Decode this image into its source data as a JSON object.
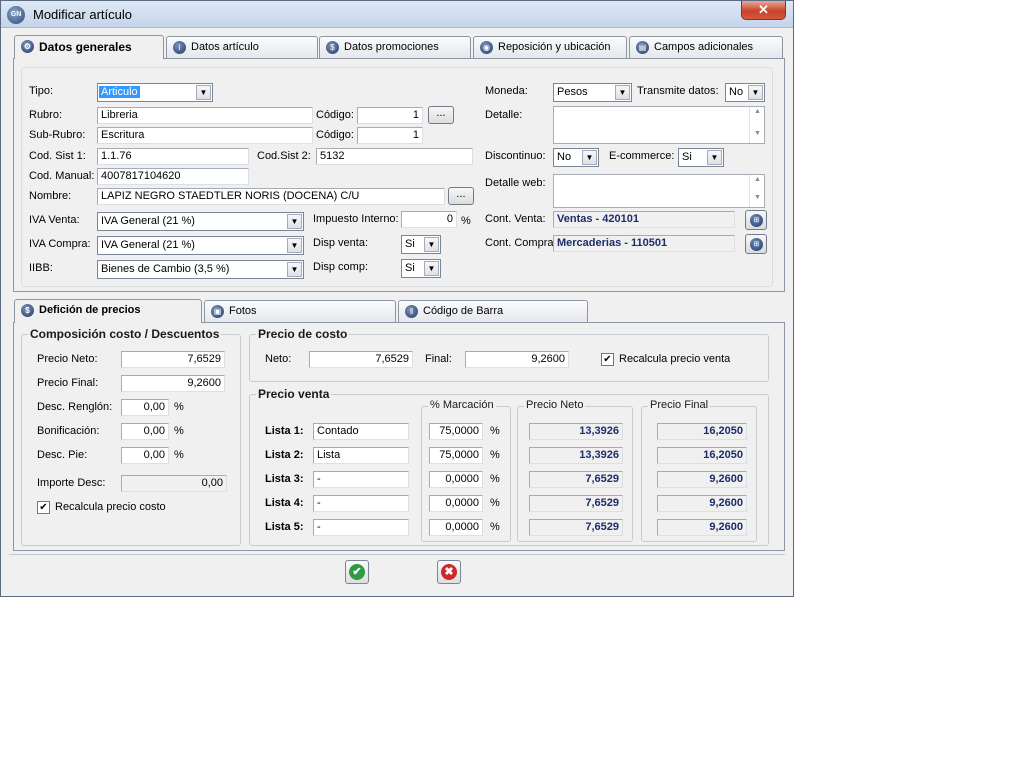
{
  "window": {
    "title": "Modificar artículo",
    "icon_text": "GN",
    "close_glyph": "✕"
  },
  "top_tabs": [
    {
      "label": "Datos generales",
      "icon": "gear-icon"
    },
    {
      "label": "Datos artículo",
      "icon": "info-icon"
    },
    {
      "label": "Datos promociones",
      "icon": "percent-icon"
    },
    {
      "label": "Reposición y ubicación",
      "icon": "box-icon"
    },
    {
      "label": "Campos adicionales",
      "icon": "folder-icon"
    }
  ],
  "general": {
    "tipo": {
      "label": "Tipo:",
      "value": "Articulo"
    },
    "rubro": {
      "label": "Rubro:",
      "value": "Libreria"
    },
    "rubro_codigo": {
      "label": "Código:",
      "value": "1"
    },
    "subrubro": {
      "label": "Sub-Rubro:",
      "value": "Escritura"
    },
    "subrubro_codigo": {
      "label": "Código:",
      "value": "1"
    },
    "cod_sist1": {
      "label": "Cod. Sist 1:",
      "value": "1.1.76"
    },
    "cod_sist2": {
      "label": "Cod.Sist 2:",
      "value": "5132"
    },
    "cod_manual": {
      "label": "Cod. Manual:",
      "value": "4007817104620"
    },
    "nombre": {
      "label": "Nombre:",
      "value": "LAPIZ NEGRO STAEDTLER NORIS (DOCENA) C/U"
    },
    "iva_venta": {
      "label": "IVA Venta:",
      "value": "IVA General (21 %)"
    },
    "iva_compra": {
      "label": "IVA Compra:",
      "value": "IVA General (21 %)"
    },
    "iibb": {
      "label": "IIBB:",
      "value": "Bienes de Cambio (3,5 %)"
    },
    "impuesto_interno": {
      "label": "Impuesto Interno:",
      "value": "0",
      "unit": "%"
    },
    "disp_venta": {
      "label": "Disp venta:",
      "value": "Si"
    },
    "disp_comp": {
      "label": "Disp comp:",
      "value": "Si"
    },
    "moneda": {
      "label": "Moneda:",
      "value": "Pesos"
    },
    "transmite": {
      "label": "Transmite datos:",
      "value": "No"
    },
    "detalle": {
      "label": "Detalle:",
      "value": ""
    },
    "discontinuo": {
      "label": "Discontinuo:",
      "value": "No"
    },
    "ecommerce": {
      "label": "E-commerce:",
      "value": "Si"
    },
    "detalle_web": {
      "label": "Detalle web:",
      "value": ""
    },
    "cont_venta": {
      "label": "Cont. Venta:",
      "value": "Ventas - 420101"
    },
    "cont_compra": {
      "label": "Cont. Compra:",
      "value": "Mercaderias - 110501"
    },
    "ellipsis": "..."
  },
  "bottom_tabs": [
    {
      "label": "Defición de precios",
      "icon": "dollar-icon"
    },
    {
      "label": "Fotos",
      "icon": "photo-icon"
    },
    {
      "label": "Código de Barra",
      "icon": "barcode-icon"
    }
  ],
  "composicion": {
    "title": "Composición costo / Descuentos",
    "precio_neto": {
      "label": "Precio Neto:",
      "value": "7,6529"
    },
    "precio_final": {
      "label": "Precio Final:",
      "value": "9,2600"
    },
    "desc_renglon": {
      "label": "Desc. Renglón:",
      "value": "0,00",
      "unit": "%"
    },
    "bonificacion": {
      "label": "Bonificación:",
      "value": "0,00",
      "unit": "%"
    },
    "desc_pie": {
      "label": "Desc. Pie:",
      "value": "0,00",
      "unit": "%"
    },
    "importe_desc": {
      "label": "Importe Desc:",
      "value": "0,00"
    },
    "recalcula_costo": {
      "label": "Recalcula precio costo",
      "checked": true
    }
  },
  "precio_costo": {
    "title": "Precio de costo",
    "neto": {
      "label": "Neto:",
      "value": "7,6529"
    },
    "final": {
      "label": "Final:",
      "value": "9,2600"
    },
    "recalcula_venta": {
      "label": "Recalcula precio venta",
      "checked": true
    }
  },
  "precio_venta": {
    "title": "Precio venta",
    "col_marcacion": "% Marcación",
    "col_neto": "Precio Neto",
    "col_final": "Precio Final",
    "unit": "%",
    "listas": [
      {
        "label": "Lista 1:",
        "name": "Contado",
        "marcacion": "75,0000",
        "neto": "13,3926",
        "final": "16,2050"
      },
      {
        "label": "Lista 2:",
        "name": "Lista",
        "marcacion": "75,0000",
        "neto": "13,3926",
        "final": "16,2050"
      },
      {
        "label": "Lista 3:",
        "name": "-",
        "marcacion": "0,0000",
        "neto": "7,6529",
        "final": "9,2600"
      },
      {
        "label": "Lista 4:",
        "name": "-",
        "marcacion": "0,0000",
        "neto": "7,6529",
        "final": "9,2600"
      },
      {
        "label": "Lista 5:",
        "name": "-",
        "marcacion": "0,0000",
        "neto": "7,6529",
        "final": "9,2600"
      }
    ]
  },
  "actions": {
    "accept_glyph": "✔",
    "cancel_glyph": "✖",
    "accept_color": "#2e9b45",
    "cancel_color": "#d1262b"
  }
}
